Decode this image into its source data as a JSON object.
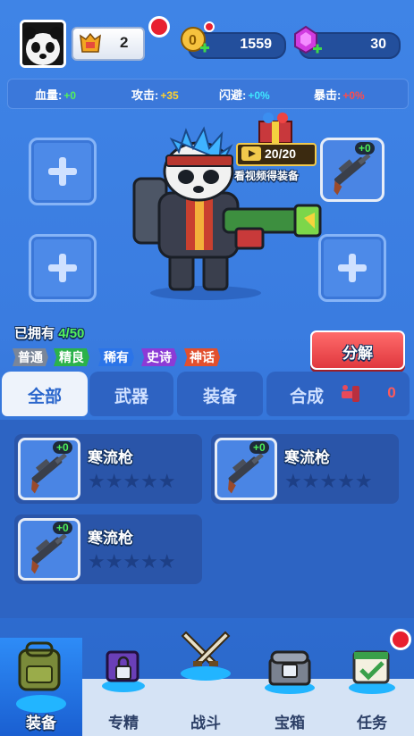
{
  "profile": {
    "avatar_icon": "panda-avatar-icon",
    "rank_icon": "crown-badge-icon",
    "rank_value": "2"
  },
  "currency": {
    "coins": {
      "icon": "gold-coin-icon",
      "value": "1559"
    },
    "gems": {
      "icon": "purple-gem-icon",
      "value": "30"
    }
  },
  "stats": [
    {
      "label": "血量:",
      "value": "+0",
      "color": "#53f15c"
    },
    {
      "label": "攻击:",
      "value": "+35",
      "color": "#ffd22c"
    },
    {
      "label": "闪避:",
      "value": "+0%",
      "color": "#3fe6ff"
    },
    {
      "label": "暴击:",
      "value": "+0%",
      "color": "#ff4b4b"
    }
  ],
  "equip_slots": {
    "empty_icon": "plus-icon",
    "equipped_item_level": "+0"
  },
  "video_reward": {
    "count": "20/20",
    "caption": "看视频得装备"
  },
  "inventory": {
    "owned_label": "已拥有",
    "owned_count": "4/50",
    "rarities": [
      "普通",
      "精良",
      "稀有",
      "史诗",
      "神话"
    ],
    "decompose_label": "分解"
  },
  "tabs": [
    {
      "label": "全部",
      "active": true
    },
    {
      "label": "武器",
      "active": false
    },
    {
      "label": "装备",
      "active": false
    },
    {
      "label": "合成",
      "active": false,
      "count": "0"
    }
  ],
  "items": [
    {
      "name": "寒流枪",
      "level": "+0",
      "stars": 5
    },
    {
      "name": "寒流枪",
      "level": "+0",
      "stars": 5
    },
    {
      "name": "寒流枪",
      "level": "+0",
      "stars": 5
    }
  ],
  "bottom_nav": [
    {
      "label": "装备",
      "icon": "backpack-icon",
      "active": true
    },
    {
      "label": "专精",
      "icon": "locked-book-icon",
      "active": false
    },
    {
      "label": "战斗",
      "icon": "crossed-swords-icon",
      "active": false
    },
    {
      "label": "宝箱",
      "icon": "locked-chest-icon",
      "active": false
    },
    {
      "label": "任务",
      "icon": "task-calendar-icon",
      "active": false
    }
  ]
}
